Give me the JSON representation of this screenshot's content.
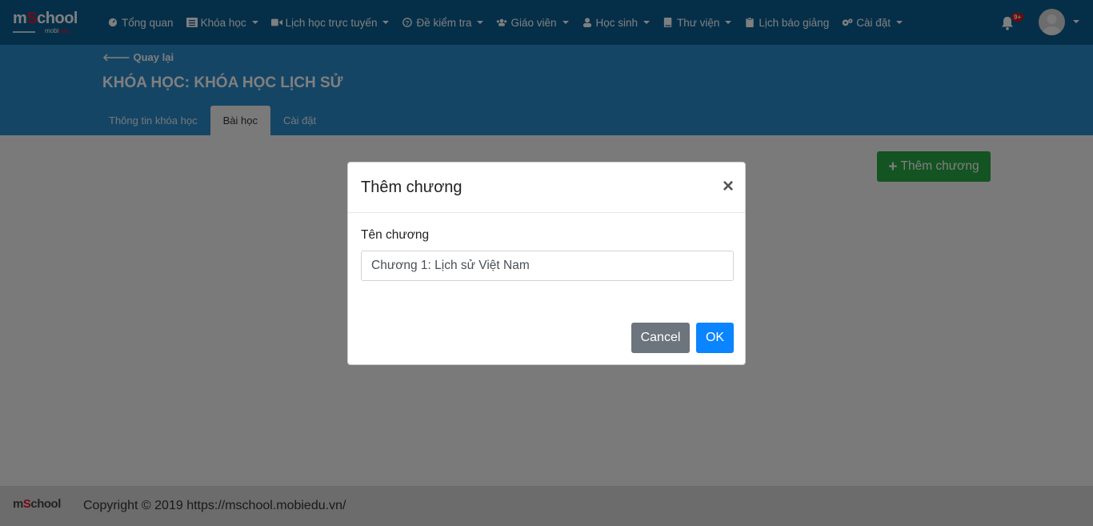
{
  "brand": {
    "logo_main_a": "m",
    "logo_main_b": "S",
    "logo_main_c": "chool",
    "logo_sub_a": "mobi",
    "logo_sub_b": "edu"
  },
  "nav": {
    "items": [
      {
        "label": "Tổng quan",
        "icon": "dashboard-icon",
        "dropdown": false
      },
      {
        "label": "Khóa học",
        "icon": "list-icon",
        "dropdown": true
      },
      {
        "label": "Lịch học trực tuyến",
        "icon": "video-icon",
        "dropdown": true
      },
      {
        "label": "Đề kiểm tra",
        "icon": "question-circle-icon",
        "dropdown": true
      },
      {
        "label": "Giáo viên",
        "icon": "users-icon",
        "dropdown": true
      },
      {
        "label": "Học sinh",
        "icon": "user-icon",
        "dropdown": true
      },
      {
        "label": "Thư viện",
        "icon": "book-icon",
        "dropdown": true
      },
      {
        "label": "Lịch báo giảng",
        "icon": "clipboard-icon",
        "dropdown": false
      },
      {
        "label": "Cài đặt",
        "icon": "cogs-icon",
        "dropdown": true
      }
    ],
    "notification_badge": "9+"
  },
  "header": {
    "back_label": "Quay lại",
    "course_title": "KHÓA HỌC: KHÓA HỌC LỊCH SỬ",
    "tabs": [
      {
        "label": "Thông tin khóa học",
        "active": false
      },
      {
        "label": "Bài học",
        "active": true
      },
      {
        "label": "Cài đặt",
        "active": false
      }
    ]
  },
  "main": {
    "add_chapter_label": "Thêm chương"
  },
  "modal": {
    "title": "Thêm chương",
    "field_label": "Tên chương",
    "field_value": "Chương 1: Lịch sử Việt Nam",
    "cancel_label": "Cancel",
    "ok_label": "OK"
  },
  "footer": {
    "copyright": "Copyright © 2019 https://mschool.mobiedu.vn/"
  },
  "colors": {
    "navbar": "#0a5f93",
    "header": "#2a8bc8",
    "success": "#28a745",
    "primary": "#0a84ff",
    "secondary": "#6c757d"
  }
}
